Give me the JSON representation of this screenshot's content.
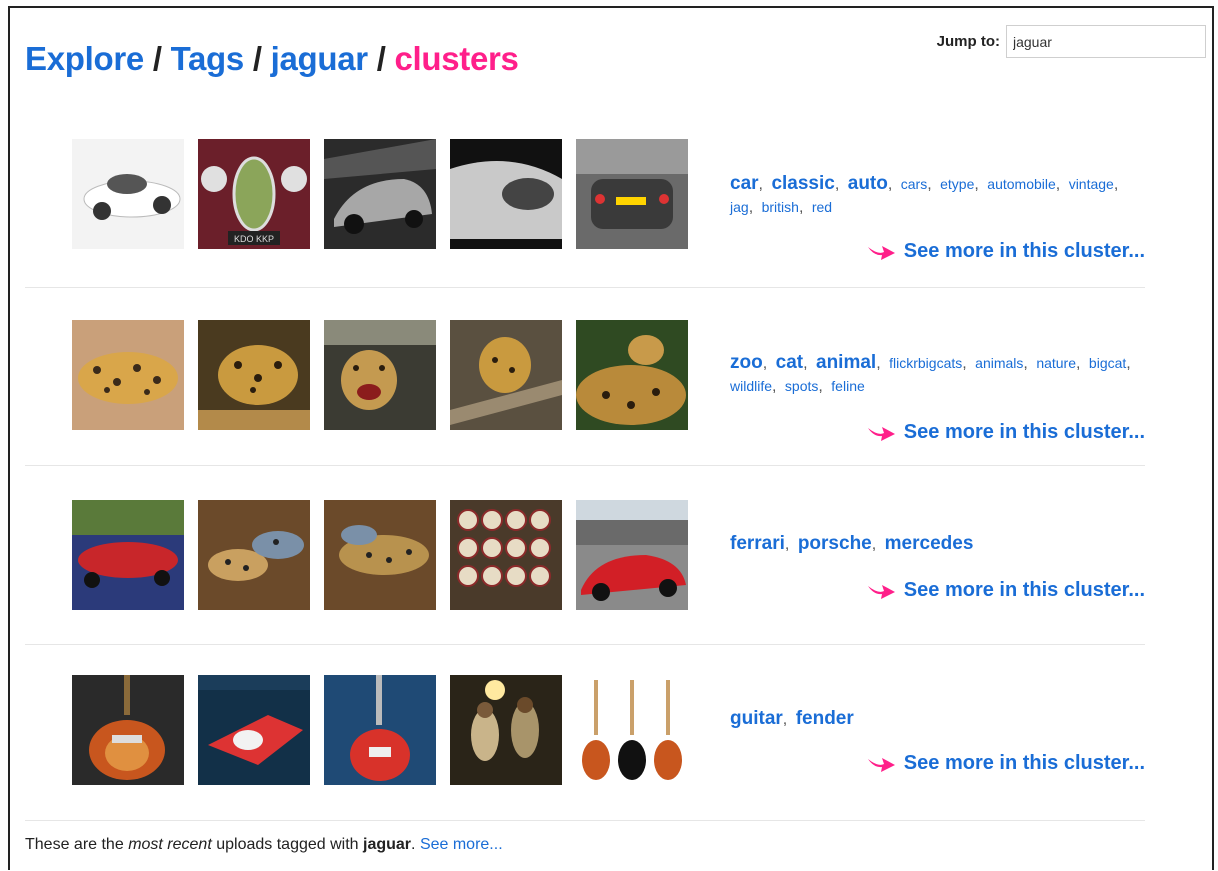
{
  "breadcrumb": {
    "explore": "Explore",
    "tags": "Tags",
    "tag": "jaguar",
    "current": "clusters",
    "separator": "/"
  },
  "jump": {
    "label": "Jump to:",
    "value": "jaguar"
  },
  "see_more_cluster": "See more in this cluster...",
  "clusters": [
    {
      "tags_large": [
        "car",
        "classic",
        "auto"
      ],
      "tags_small": [
        "cars",
        "etype",
        "automobile",
        "vintage",
        "jag",
        "british",
        "red"
      ],
      "thumbs": [
        "white-vintage-race-car",
        "red-classic-car-grille",
        "silver-sedan-in-tunnel",
        "silver-car-closeup",
        "car-rear-in-garage"
      ]
    },
    {
      "tags_large": [
        "zoo",
        "cat",
        "animal"
      ],
      "tags_small": [
        "flickrbigcats",
        "animals",
        "nature",
        "bigcat",
        "wildlife",
        "spots",
        "feline"
      ],
      "thumbs": [
        "jaguar-lying-on-branch",
        "jaguar-walking",
        "jaguar-snarling",
        "jaguar-on-tree",
        "jaguar-resting-in-grass"
      ]
    },
    {
      "tags_large": [
        "ferrari",
        "porsche",
        "mercedes"
      ],
      "tags_small": [],
      "thumbs": [
        "colorful-cars-garden",
        "jaguar-cubs-playing",
        "jaguar-cubs-resting",
        "car-badge-collection",
        "red-race-car-parking"
      ]
    },
    {
      "tags_large": [
        "guitar",
        "fender"
      ],
      "tags_small": [],
      "thumbs": [
        "sunburst-guitar-body",
        "red-guitar-on-blue",
        "red-guitar-in-case",
        "band-on-stage",
        "three-guitars"
      ]
    }
  ],
  "footer": {
    "prefix": "These are the",
    "emphasis": "most recent",
    "middle": "uploads tagged with",
    "tag": "jaguar",
    "suffix": ".",
    "link": "See more..."
  },
  "colors": {
    "link": "#1a6dd6",
    "accent": "#ff1f8a",
    "divider": "#e6e6e6"
  }
}
